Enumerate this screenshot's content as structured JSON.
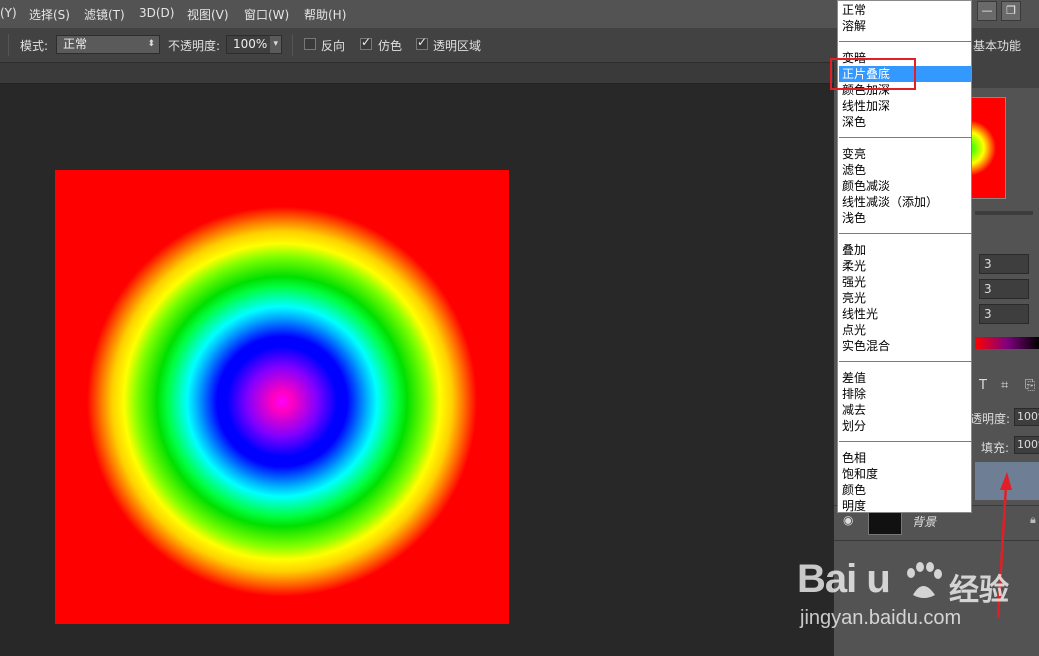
{
  "menu": [
    "(Y)",
    "选择(S)",
    "滤镜(T)",
    "3D(D)",
    "视图(V)",
    "窗口(W)",
    "帮助(H)"
  ],
  "window_buttons": {
    "minimize": "—",
    "restore": "❐"
  },
  "options": {
    "mode_label": "模式:",
    "mode_value": "正常",
    "opacity_label": "不透明度:",
    "opacity_value": "100%",
    "reverse_label": "反向",
    "dither_label": "仿色",
    "transparency_label": "透明区域",
    "reverse_checked": false,
    "dither_checked": true,
    "transparency_checked": true
  },
  "workspace_label": "基本功能",
  "blend_modes": {
    "groups": [
      [
        "正常",
        "溶解"
      ],
      [
        "变暗",
        "正片叠底",
        "颜色加深",
        "线性加深",
        "深色"
      ],
      [
        "变亮",
        "滤色",
        "颜色减淡",
        "线性减淡（添加）",
        "浅色"
      ],
      [
        "叠加",
        "柔光",
        "强光",
        "亮光",
        "线性光",
        "点光",
        "实色混合"
      ],
      [
        "差值",
        "排除",
        "减去",
        "划分"
      ],
      [
        "色相",
        "饱和度",
        "颜色",
        "明度"
      ]
    ],
    "selected": "正片叠底"
  },
  "panel": {
    "fields": [
      "3",
      "3",
      "3"
    ],
    "opacity_label": "透明度:",
    "opacity_value": "100%",
    "fill_label": "填充:",
    "fill_value": "100%",
    "layer_name": "背景",
    "tool_icons": [
      "T",
      "⌗",
      "⎘"
    ]
  },
  "watermark": {
    "logo": "Bai  u",
    "cn": "经验",
    "url": "jingyan.baidu.com"
  },
  "colors": {
    "highlight": "#3399ff",
    "annotation_red": "#e21f26",
    "layer_selected": "#6e7f95"
  }
}
